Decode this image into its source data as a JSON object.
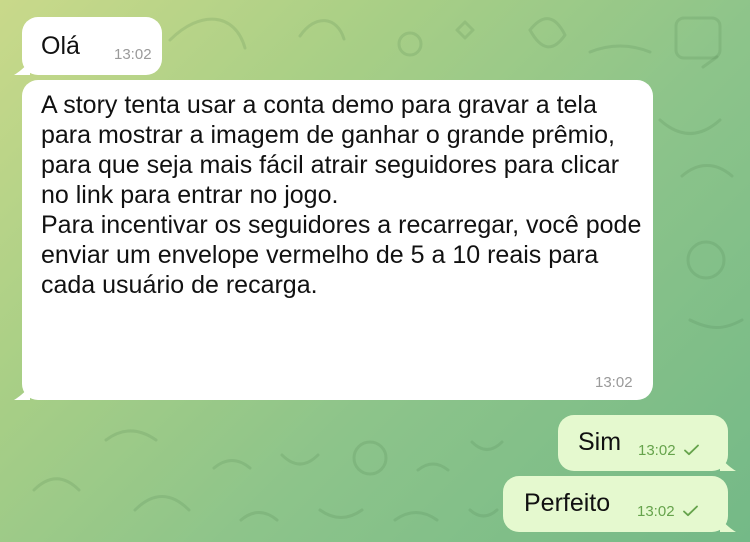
{
  "chat": {
    "messages": [
      {
        "direction": "incoming",
        "text": "Olá",
        "time": "13:02"
      },
      {
        "direction": "incoming",
        "text": "A story tenta usar a conta demo para gravar a tela para mostrar a imagem de ganhar o grande prêmio,\npara que seja mais fácil atrair seguidores para clicar no link para entrar no jogo.\nPara incentivar os seguidores a recarregar, você pode enviar um envelope vermelho de 5 a 10 reais para cada usuário de recarga.",
        "time": "13:02"
      },
      {
        "direction": "outgoing",
        "text": "Sim",
        "time": "13:02",
        "status_icon": "single-check-icon"
      },
      {
        "direction": "outgoing",
        "text": "Perfeito",
        "time": "13:02",
        "status_icon": "single-check-icon"
      }
    ]
  },
  "theme": {
    "incoming_bubble": "#ffffff",
    "outgoing_bubble": "#e5f9cf",
    "outgoing_meta": "#66a34c",
    "incoming_meta": "#9a9a9a",
    "wallpaper_start": "#c9d98a",
    "wallpaper_end": "#74b987"
  }
}
